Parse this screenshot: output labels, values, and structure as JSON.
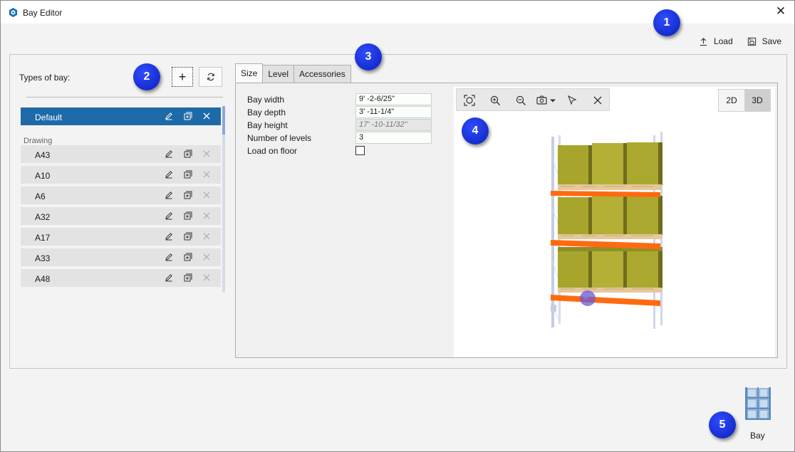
{
  "window": {
    "title": "Bay Editor",
    "icon": "bay-editor-app-icon",
    "close_glyph": "✕"
  },
  "actions": {
    "load_label": "Load",
    "save_label": "Save"
  },
  "callouts": [
    "1",
    "2",
    "3",
    "4",
    "5"
  ],
  "types_panel": {
    "label": "Types of bay:",
    "add_glyph": "+",
    "refresh_glyph": "⟳",
    "group_label": "Drawing",
    "selected_item": "Default",
    "items": [
      "A43",
      "A10",
      "A6",
      "A32",
      "A17",
      "A33",
      "A48"
    ]
  },
  "tabs": [
    "Size",
    "Level",
    "Accessories"
  ],
  "size_tab": {
    "fields": [
      {
        "label": "Bay width",
        "value": "9' -2-6/25\""
      },
      {
        "label": "Bay depth",
        "value": "3' -11-1/4\""
      },
      {
        "label": "Bay height",
        "value": "17' -10-11/32\""
      },
      {
        "label": "Number of levels",
        "value": "3"
      },
      {
        "label": "Load on floor",
        "value": ""
      }
    ]
  },
  "viewport": {
    "toolbar_icons": [
      "zoom-extents-icon",
      "zoom-in-icon",
      "zoom-out-icon",
      "camera-icon",
      "select-arrow-icon",
      "clear-icon"
    ],
    "view_2d": "2D",
    "view_3d": "3D",
    "active_view": "3D"
  },
  "bay_button": {
    "label": "Bay"
  },
  "colors": {
    "selection": "#1e6aa8",
    "callout": "#0a1fb8",
    "beam": "#ff6a10",
    "box": "#a8a52c",
    "pallet": "#e6c79a",
    "upright": "#cbd2e8"
  }
}
